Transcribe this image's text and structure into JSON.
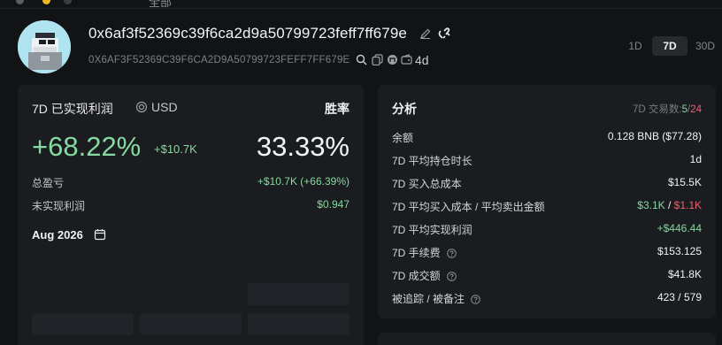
{
  "topbar": {
    "partial_label": "全部"
  },
  "wallet": {
    "address": "0x6af3f52369c39f6ca2d9a50799723feff7ff679e",
    "address_upper": "0X6AF3F52369C39F6CA2D9A50799723FEFF7FF679E",
    "age": "4d",
    "icons": [
      "edit-icon",
      "link-icon",
      "search-icon",
      "copy-icon",
      "explorer-icon",
      "wallet-icon"
    ]
  },
  "range_tabs": {
    "items": [
      "1D",
      "7D",
      "30D"
    ],
    "selected": "7D"
  },
  "pnl": {
    "title": "7D 已实现利润",
    "currency": "USD",
    "winrate_label": "胜率",
    "pct": "+68.22%",
    "abs": "+$10.7K",
    "winrate": "33.33%",
    "rows": [
      {
        "label": "总盈亏",
        "value": "+$10.7K (+66.39%)"
      },
      {
        "label": "未实现利润",
        "value": "$0.947"
      }
    ],
    "month": "Aug 2026"
  },
  "analysis": {
    "title": "分析",
    "count_label": "7D 交易数:",
    "count_win": "5",
    "count_sep": "/",
    "count_total": "24",
    "rows": [
      {
        "label": "余额",
        "value": "0.128 BNB ($77.28)"
      },
      {
        "label": "7D 平均持仓时长",
        "value": "1d"
      },
      {
        "label": "7D 买入总成本",
        "value": "$15.5K"
      },
      {
        "label": "7D 平均买入成本 / 平均卖出金额",
        "value_buy": "$3.1K",
        "value_sep": " / ",
        "value_sell": "$1.1K"
      },
      {
        "label": "7D 平均实现利润",
        "value": "+$446.44"
      },
      {
        "label": "7D 手续费",
        "value": "$153.125"
      },
      {
        "label": "7D 成交额",
        "value": "$41.8K"
      },
      {
        "label": "被追踪 / 被备注",
        "value": "423 / 579"
      }
    ]
  },
  "colors": {
    "background": "#111315",
    "card": "#1a1c1f",
    "positive": "#86d9a0",
    "negative": "#ef5f6e"
  }
}
